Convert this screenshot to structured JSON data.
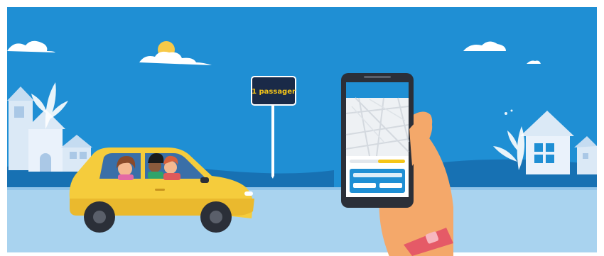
{
  "scene": {
    "sign": {
      "text": "1 passager"
    },
    "colors": {
      "sky": "#1f8fd4",
      "ground": "#a9d3ef",
      "hills": "#1771b3",
      "car": "#f5cc3c",
      "phone_frame": "#2b2f38",
      "phone_accent": "#1f8fd4",
      "sign_board": "#1a2a48",
      "sign_text": "#f5c518",
      "hand": "#f4a86a",
      "watch_band": "#e55a67",
      "houses": "#dbe9f6"
    }
  }
}
